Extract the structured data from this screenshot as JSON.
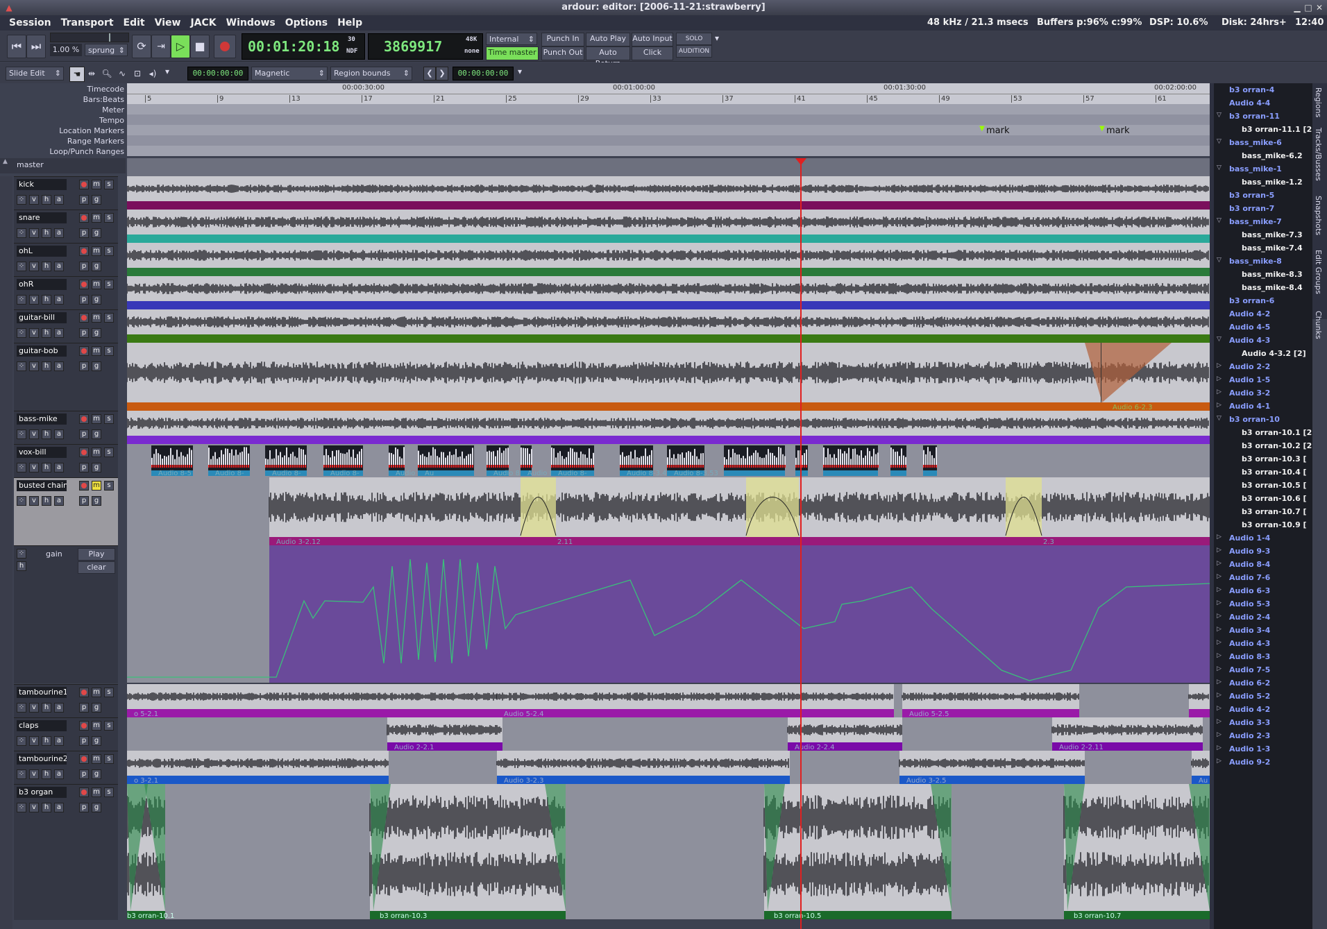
{
  "window": {
    "title": "ardour: editor: [2006-11-21:strawberry]"
  },
  "menu": {
    "items": [
      "Session",
      "Transport",
      "Edit",
      "View",
      "JACK",
      "Windows",
      "Options",
      "Help"
    ]
  },
  "status": {
    "rate": "48 kHz / 21.3 msecs",
    "buffers": "Buffers p:96% c:99%",
    "dsp": "DSP: 10.6%",
    "disk": "Disk: 24hrs+",
    "time": "12:40"
  },
  "transport": {
    "shuttle_speed": "1.00",
    "shuttle_percent": "%",
    "shuttle_mode": "sprung",
    "primary_clock": "00:01:20:18",
    "clock_fps": "30",
    "clock_ndf": "NDF",
    "secondary_clock": "3869917",
    "secondary_rate": "48K",
    "secondary_none": "none",
    "sync_source": "Internal",
    "time_master": "Time master",
    "punch_in": "Punch In",
    "punch_out": "Punch Out",
    "auto_play": "Auto Play",
    "auto_return": "Auto Return",
    "auto_input": "Auto Input",
    "click": "Click",
    "solo": "SOLO",
    "audition": "AUDITION"
  },
  "editbar": {
    "edit_mode": "Slide Edit",
    "nudge_clock": "00:00:00:00",
    "snap_mode": "Magnetic",
    "snap_type": "Region bounds",
    "zoom_clock": "00:00:00:00"
  },
  "ruler_labels": [
    "Timecode",
    "Bars:Beats",
    "Meter",
    "Tempo",
    "Location Markers",
    "Range Markers",
    "Loop/Punch Ranges"
  ],
  "timecode_ticks": [
    "00:00:30:00",
    "00:01:00:00",
    "00:01:30:00",
    "00:02:00:00"
  ],
  "bar_ticks": [
    "5",
    "9",
    "13",
    "17",
    "21",
    "25",
    "29",
    "33",
    "37",
    "41",
    "45",
    "49",
    "53",
    "57",
    "61"
  ],
  "markers": [
    "mark",
    "mark"
  ],
  "master_label": "master",
  "track_buttons": {
    "mute": "m",
    "solo": "s",
    "playlist": "p",
    "group": "g",
    "vis": "v",
    "hide": "h",
    "auto": "a"
  },
  "tracks": [
    {
      "name": "kick",
      "color": "#7a0f5c"
    },
    {
      "name": "snare",
      "color": "#2aa99a"
    },
    {
      "name": "ohL",
      "color": "#2a7a3a"
    },
    {
      "name": "ohR",
      "color": "#3838b8"
    },
    {
      "name": "guitar-bill",
      "color": "#3a7a14"
    },
    {
      "name": "guitar-bob",
      "color": "#c85a10"
    },
    {
      "name": "bass-mike",
      "color": "#7a2ad0"
    },
    {
      "name": "vox-bill",
      "color": "#2a8ab8"
    },
    {
      "name": "busted chain",
      "color": "#9a1a7a"
    },
    {
      "name": "tambourine1",
      "color": "#9a1aa8"
    },
    {
      "name": "claps",
      "color": "#7a0aa8"
    },
    {
      "name": "tambourine2",
      "color": "#1a58c8"
    },
    {
      "name": "b3 organ",
      "color": "#1a6a2a"
    }
  ],
  "automation": {
    "label": "gain",
    "play": "Play",
    "clear": "clear",
    "hide": "h"
  },
  "region_labels": {
    "guitar_bob": "Audio 6-2.3",
    "vox_bill": [
      "Audio 8-5",
      "Audio 8-",
      "Audio 8-",
      "Audio 8-",
      "Audio 8-3.37",
      "Au",
      "Audio 8-",
      "Audio 8-",
      "Audio 8-",
      "Audio 8-3.49",
      "Audio 8-3.53"
    ],
    "busted": [
      "Audio 3-2.12",
      "2.11",
      "2.3"
    ],
    "tambourine1": [
      "o 5-2.1",
      "Audio 5-2.4",
      "Audio 5-2.5"
    ],
    "claps": [
      "Audio 2-2.1",
      "Audio 2-2.4",
      "Audio 2-2.11"
    ],
    "tambourine2": [
      "o 3-2.1",
      "Audio 3-2.3",
      "Audio 3-2.5",
      "Au"
    ],
    "b3": [
      "b3 orran-10.1",
      "b3 orran-10.3",
      "b3 orran-10.5",
      "b3 orran-10.7"
    ]
  },
  "regions_list": [
    {
      "t": "top",
      "label": "b3 orran-4"
    },
    {
      "t": "top",
      "label": "Audio 4-4"
    },
    {
      "t": "top",
      "label": "b3 orran-11",
      "arrow": "down"
    },
    {
      "t": "sub",
      "label": "b3 orran-11.1  [2"
    },
    {
      "t": "top",
      "label": "bass_mike-6",
      "arrow": "down"
    },
    {
      "t": "sub",
      "label": "bass_mike-6.2"
    },
    {
      "t": "top",
      "label": "bass_mike-1",
      "arrow": "down"
    },
    {
      "t": "sub",
      "label": "bass_mike-1.2"
    },
    {
      "t": "top",
      "label": "b3 orran-5"
    },
    {
      "t": "top",
      "label": "b3 orran-7"
    },
    {
      "t": "top",
      "label": "bass_mike-7",
      "arrow": "down"
    },
    {
      "t": "sub",
      "label": "bass_mike-7.3"
    },
    {
      "t": "sub",
      "label": "bass_mike-7.4"
    },
    {
      "t": "top",
      "label": "bass_mike-8",
      "arrow": "down"
    },
    {
      "t": "sub",
      "label": "bass_mike-8.3"
    },
    {
      "t": "sub",
      "label": "bass_mike-8.4"
    },
    {
      "t": "top",
      "label": "b3 orran-6"
    },
    {
      "t": "top",
      "label": "Audio 4-2"
    },
    {
      "t": "top",
      "label": "Audio 4-5"
    },
    {
      "t": "top",
      "label": "Audio 4-3",
      "arrow": "down"
    },
    {
      "t": "sub",
      "label": "Audio 4-3.2  [2]"
    },
    {
      "t": "top",
      "label": "Audio 2-2",
      "arrow": "right"
    },
    {
      "t": "top",
      "label": "Audio 1-5",
      "arrow": "right"
    },
    {
      "t": "top",
      "label": "Audio 3-2",
      "arrow": "right"
    },
    {
      "t": "top",
      "label": "Audio 4-1",
      "arrow": "right"
    },
    {
      "t": "top",
      "label": "b3 orran-10",
      "arrow": "down"
    },
    {
      "t": "sub",
      "label": "b3 orran-10.1  [2"
    },
    {
      "t": "sub",
      "label": "b3 orran-10.2  [2"
    },
    {
      "t": "sub",
      "label": "b3 orran-10.3  ["
    },
    {
      "t": "sub",
      "label": "b3 orran-10.4  ["
    },
    {
      "t": "sub",
      "label": "b3 orran-10.5  ["
    },
    {
      "t": "sub",
      "label": "b3 orran-10.6  ["
    },
    {
      "t": "sub",
      "label": "b3 orran-10.7  ["
    },
    {
      "t": "sub",
      "label": "b3 orran-10.9  ["
    },
    {
      "t": "top",
      "label": "Audio 1-4",
      "arrow": "right"
    },
    {
      "t": "top",
      "label": "Audio 9-3",
      "arrow": "right"
    },
    {
      "t": "top",
      "label": "Audio 8-4",
      "arrow": "right"
    },
    {
      "t": "top",
      "label": "Audio 7-6",
      "arrow": "right"
    },
    {
      "t": "top",
      "label": "Audio 6-3",
      "arrow": "right"
    },
    {
      "t": "top",
      "label": "Audio 5-3",
      "arrow": "right"
    },
    {
      "t": "top",
      "label": "Audio 2-4",
      "arrow": "right"
    },
    {
      "t": "top",
      "label": "Audio 3-4",
      "arrow": "right"
    },
    {
      "t": "top",
      "label": "Audio 4-3",
      "arrow": "right"
    },
    {
      "t": "top",
      "label": "Audio 8-3",
      "arrow": "right"
    },
    {
      "t": "top",
      "label": "Audio 7-5",
      "arrow": "right"
    },
    {
      "t": "top",
      "label": "Audio 6-2",
      "arrow": "right"
    },
    {
      "t": "top",
      "label": "Audio 5-2",
      "arrow": "right"
    },
    {
      "t": "top",
      "label": "Audio 4-2",
      "arrow": "right"
    },
    {
      "t": "top",
      "label": "Audio 3-3",
      "arrow": "right"
    },
    {
      "t": "top",
      "label": "Audio 2-3",
      "arrow": "right"
    },
    {
      "t": "top",
      "label": "Audio 1-3",
      "arrow": "right"
    },
    {
      "t": "top",
      "label": "Audio 9-2",
      "arrow": "right"
    }
  ],
  "side_tabs": [
    "Regions",
    "Tracks/Busses",
    "Snapshots",
    "Edit Groups",
    "Chunks"
  ]
}
